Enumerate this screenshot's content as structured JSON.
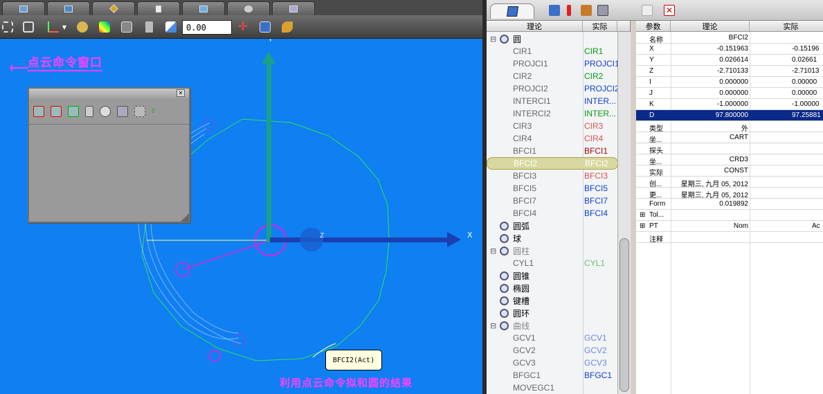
{
  "toolbar": {
    "coord_value": "0.00"
  },
  "viewport": {
    "annotation_title": "点云命令窗口",
    "annotation_result": "利用点云命令拟和圆的结果",
    "axis_x": "X",
    "axis_y": "Y",
    "axis_z": "Z",
    "tooltip": "BFCI2(Act)",
    "palette_count": "0"
  },
  "tree": {
    "header_nominal": "理论",
    "header_actual": "实际",
    "items": [
      {
        "name": "圆",
        "actual": "",
        "indent": 1,
        "icon": "circle",
        "color": "#000",
        "expand": "-"
      },
      {
        "name": "CIR1",
        "actual": "CIR1",
        "indent": 2,
        "color": "#0a9a0a"
      },
      {
        "name": "PROJCI1",
        "actual": "PROJCI1",
        "indent": 2,
        "color": "#1040d0"
      },
      {
        "name": "CIR2",
        "actual": "CIR2",
        "indent": 2,
        "color": "#0a9a0a"
      },
      {
        "name": "PROJCI2",
        "actual": "PROJCI2",
        "indent": 2,
        "color": "#1040d0"
      },
      {
        "name": "INTERCI1",
        "actual": "INTER...",
        "indent": 2,
        "color": "#1040d0"
      },
      {
        "name": "INTERCI2",
        "actual": "INTER...",
        "indent": 2,
        "color": "#0a9a0a"
      },
      {
        "name": "CIR3",
        "actual": "CIR3",
        "indent": 2,
        "color": "#e05050"
      },
      {
        "name": "CIR4",
        "actual": "CIR4",
        "indent": 2,
        "color": "#e05050"
      },
      {
        "name": "BFCI1",
        "actual": "BFCI1",
        "indent": 2,
        "color": "#b00000"
      },
      {
        "name": "BFCI2",
        "actual": "BFCI2",
        "indent": 2,
        "color": "#ffffff",
        "selected": true
      },
      {
        "name": "BFCI3",
        "actual": "BFCI3",
        "indent": 2,
        "color": "#e05050"
      },
      {
        "name": "BFCI5",
        "actual": "BFCI5",
        "indent": 2,
        "color": "#1040d0"
      },
      {
        "name": "BFCI7",
        "actual": "BFCI7",
        "indent": 2,
        "color": "#1040d0"
      },
      {
        "name": "BFCI4",
        "actual": "BFCI4",
        "indent": 2,
        "color": "#1040d0"
      },
      {
        "name": "圆弧",
        "actual": "",
        "indent": 1,
        "icon": "arc",
        "color": "#000"
      },
      {
        "name": "球",
        "actual": "",
        "indent": 1,
        "icon": "sphere",
        "color": "#000"
      },
      {
        "name": "圆柱",
        "actual": "",
        "indent": 1,
        "icon": "cylinder",
        "color": "#888",
        "expand": "-"
      },
      {
        "name": "CYL1",
        "actual": "CYL1",
        "indent": 2,
        "color": "#6ac06a"
      },
      {
        "name": "圆锥",
        "actual": "",
        "indent": 1,
        "icon": "cone",
        "color": "#000"
      },
      {
        "name": "椭圆",
        "actual": "",
        "indent": 1,
        "icon": "ellipse",
        "color": "#000"
      },
      {
        "name": "键槽",
        "actual": "",
        "indent": 1,
        "icon": "slot",
        "color": "#000"
      },
      {
        "name": "圆环",
        "actual": "",
        "indent": 1,
        "icon": "torus",
        "color": "#000"
      },
      {
        "name": "曲线",
        "actual": "",
        "indent": 1,
        "icon": "curve",
        "color": "#888",
        "expand": "-"
      },
      {
        "name": "GCV1",
        "actual": "GCV1",
        "indent": 2,
        "color": "#6a8ae0"
      },
      {
        "name": "GCV2",
        "actual": "GCV2",
        "indent": 2,
        "color": "#6a8ae0"
      },
      {
        "name": "GCV3",
        "actual": "GCV3",
        "indent": 2,
        "color": "#6a8ae0"
      },
      {
        "name": "BFGC1",
        "actual": "BFGC1",
        "indent": 2,
        "color": "#1040d0"
      },
      {
        "name": "MOVEGC1",
        "actual": "",
        "indent": 2,
        "color": "#000"
      }
    ]
  },
  "grid": {
    "headers": [
      "参数",
      "理论",
      "实际"
    ],
    "rows": [
      {
        "p": "名称",
        "n": "BFCI2",
        "a": ""
      },
      {
        "p": "X",
        "n": "-0.151963",
        "a": "-0.15196"
      },
      {
        "p": "Y",
        "n": "0.026614",
        "a": "0.02661"
      },
      {
        "p": "Z",
        "n": "-2.710133",
        "a": "-2.71013"
      },
      {
        "p": "I",
        "n": "0.000000",
        "a": "0.00000"
      },
      {
        "p": "J",
        "n": "0.000000",
        "a": "0.00000"
      },
      {
        "p": "K",
        "n": "-1.000000",
        "a": "-1.00000"
      },
      {
        "p": "D",
        "n": "97.800000",
        "a": "97.25881",
        "selected": true
      },
      {
        "p": "类型",
        "n": "外",
        "a": ""
      },
      {
        "p": "坐...",
        "n": "CART",
        "a": ""
      },
      {
        "p": "探头",
        "n": "",
        "a": ""
      },
      {
        "p": "坐...",
        "n": "CRD3",
        "a": ""
      },
      {
        "p": "实际",
        "n": "CONST",
        "a": ""
      },
      {
        "p": "创...",
        "n": "星期三, 九月 05, 2012",
        "a": ""
      },
      {
        "p": "更...",
        "n": "星期三, 九月 05, 2012",
        "a": ""
      },
      {
        "p": "Form",
        "n": "0.019892",
        "a": ""
      },
      {
        "p": "Tol...",
        "n": "",
        "a": "",
        "expand": "+"
      },
      {
        "p": "PT",
        "n": "Nom",
        "a": "Ac",
        "expand": "+"
      },
      {
        "p": "注释",
        "n": "",
        "a": ""
      }
    ]
  }
}
